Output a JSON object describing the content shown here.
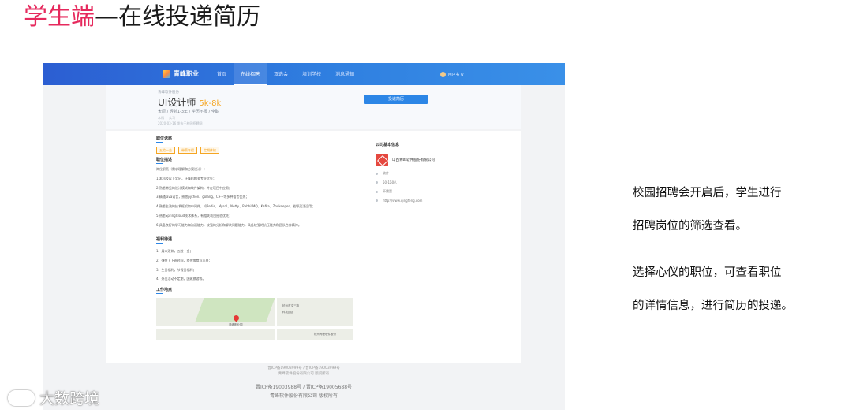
{
  "slide": {
    "title_highlight": "学生端",
    "title_rest": "—在线投递简历",
    "notes": [
      "校园招聘会开启后，学生进行",
      "招聘岗位的筛选查看。",
      "选择心仪的职位，可查看职位",
      "的详情信息，进行简历的投递。"
    ],
    "watermark": "大数跨境"
  },
  "screen": {
    "nav": {
      "logo": "青峰职业",
      "links": [
        "首页",
        "在线招聘",
        "双选会",
        "培训学校",
        "消息通知"
      ],
      "active_index": 1,
      "user": "用户名 ∨"
    },
    "job": {
      "company_small": "青峰软件股份",
      "title": "UI设计师",
      "salary": "5k-8k",
      "meta": "太原 / 经验1-3年 / 学历不限 / 全职",
      "tags": [
        "本科",
        "实习"
      ],
      "date": "2020-03-16 发布于校园招聘网",
      "apply_label": "投递简历"
    },
    "detail": {
      "tempt_title": "职位诱惑",
      "tags": [
        "五险一金",
        "带薪年假",
        "定期体检"
      ],
      "desc_title": "职位描述",
      "desc_lines": [
        "岗位职责（需求理解和方案设计）：",
        "1.本科及以上学历，计算机相关专业优先；",
        "2.熟悉常见的设计模式和软件架构，并在项目中应用；",
        "3.精通Java语言，熟悉python、golang、C++等多种语言优先；",
        "4.熟悉主流的技术框架和中间件，如Redis、Mysql、Netty、RabbitMQ、Kafka、Zookeeper，能够灵活运用；",
        "5.熟悉SpringCloud技术体系，有相关项目经验优先；",
        "6.具备良好的学习能力和沟通能力，较强的分析和解决问题能力，具备较强的抗压能力和团队合作精神。"
      ],
      "welfare_title": "福利待遇",
      "welfare_lines": [
        "1、周末双休，五险一金；",
        "2、弹性上下班时间，提供零食与水果；",
        "3、生日福利，节假日福利；",
        "4、外出活动不定期，团建旅游等。"
      ],
      "location_title": "工作地点",
      "map_labels": [
        "青峰职业园",
        "杭州市文三路",
        "科技园区",
        "杭州青峰软件股份"
      ]
    },
    "company": {
      "head": "公司基本信息",
      "name": "山西青峰软件股份有限公司",
      "info": [
        "软件",
        "50-150人",
        "不需要",
        "http://www.qingfeng.com"
      ]
    },
    "footer": {
      "small": [
        "晋ICP备19003999号 / 晋ICP备19003999号",
        "青峰软件股份有限公司 版权所有"
      ],
      "large": [
        "晋ICP备19003988号 / 晋ICP备19005688号",
        "青峰软件股份有限公司 版权所有"
      ]
    }
  }
}
